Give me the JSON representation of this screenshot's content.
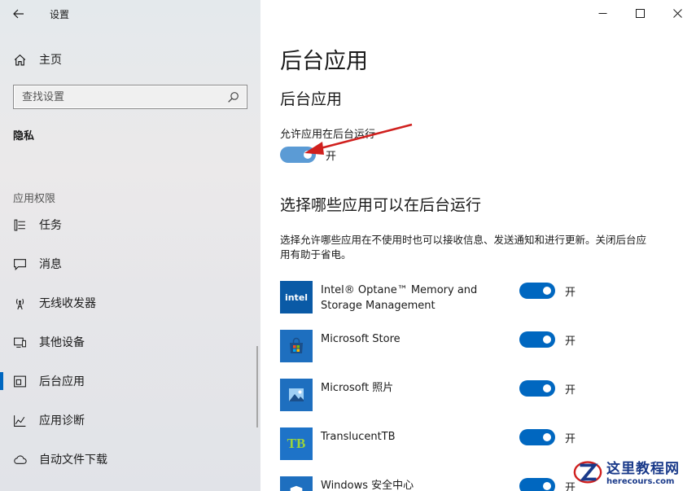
{
  "window": {
    "title": "设置"
  },
  "sidebar": {
    "home_label": "主页",
    "search_placeholder": "查找设置",
    "section_title": "隐私",
    "group_label": "应用权限",
    "items": [
      {
        "label": "任务",
        "icon": "tasks-icon"
      },
      {
        "label": "消息",
        "icon": "message-icon"
      },
      {
        "label": "无线收发器",
        "icon": "radio-tower-icon"
      },
      {
        "label": "其他设备",
        "icon": "devices-icon"
      },
      {
        "label": "后台应用",
        "icon": "background-apps-icon",
        "active": true
      },
      {
        "label": "应用诊断",
        "icon": "diagnostics-icon"
      },
      {
        "label": "自动文件下载",
        "icon": "cloud-icon"
      }
    ]
  },
  "main": {
    "page_title": "后台应用",
    "sub_title": "后台应用",
    "allow_label": "允许应用在后台运行",
    "allow_state": "开",
    "choose_title": "选择哪些应用可以在后台运行",
    "description": "选择允许哪些应用在不使用时也可以接收信息、发送通知和进行更新。关闭后台应用有助于省电。",
    "apps": [
      {
        "name": "Intel® Optane™ Memory and Storage Management",
        "state": "开",
        "icon": "intel-icon",
        "icon_text": "intel",
        "icon_color": "#0a5aa6"
      },
      {
        "name": "Microsoft Store",
        "state": "开",
        "icon": "store-icon",
        "icon_color": "#1e6fbf"
      },
      {
        "name": "Microsoft 照片",
        "state": "开",
        "icon": "photos-icon",
        "icon_color": "#1e6fbf"
      },
      {
        "name": "TranslucentTB",
        "state": "开",
        "icon": "translucenttb-icon",
        "icon_text": "TB",
        "icon_color": "#1e73c8"
      },
      {
        "name": "Windows 安全中心",
        "state": "开",
        "icon": "shield-icon",
        "icon_color": "#1e6fbf"
      }
    ]
  },
  "watermark": {
    "cn": "这里教程网",
    "en": "herecours.com"
  },
  "colors": {
    "accent": "#0067c0",
    "annotation_arrow": "#d0201e"
  }
}
